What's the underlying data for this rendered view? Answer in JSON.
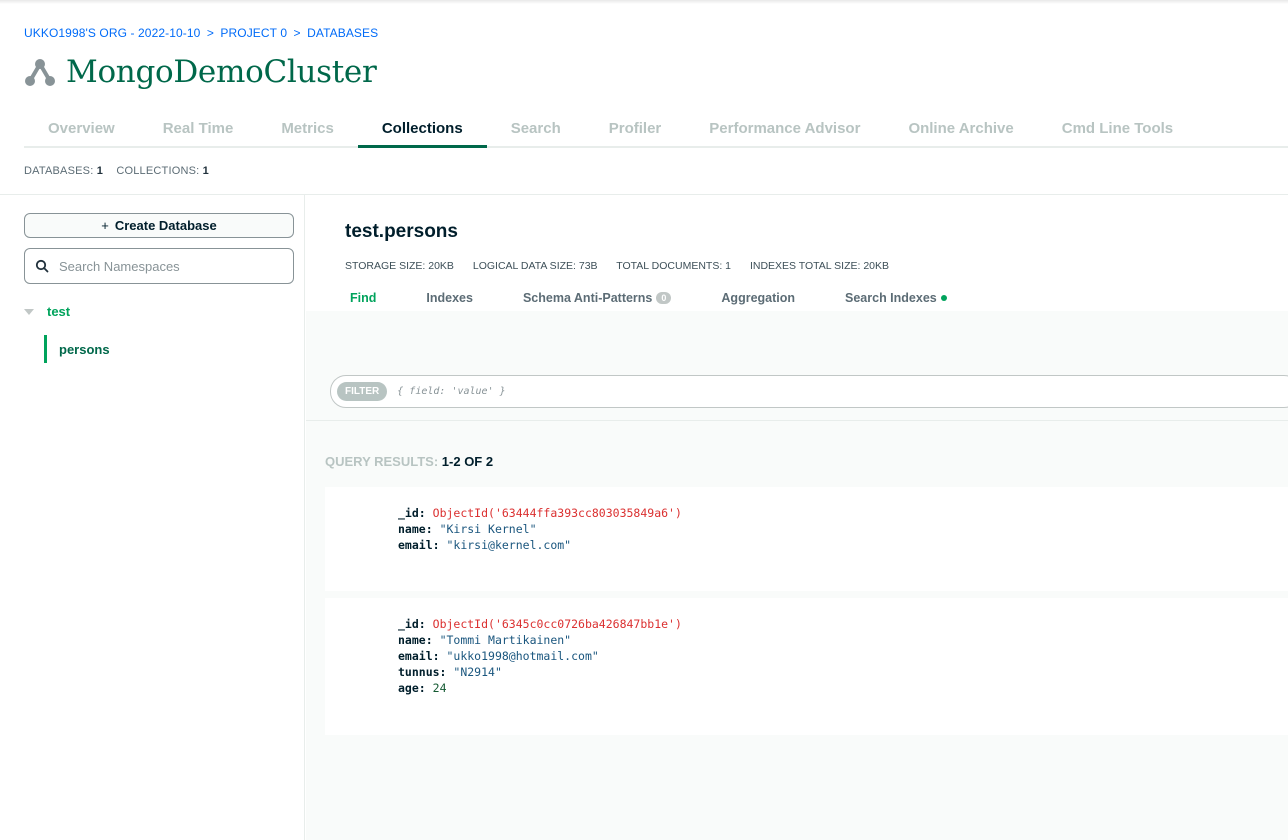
{
  "breadcrumb": {
    "org": "UKKO1998'S ORG - 2022-10-10",
    "project": "PROJECT 0",
    "section": "DATABASES",
    "separator": ">"
  },
  "page_title": "MongoDemoCluster",
  "icon_cluster": "cluster-icon",
  "tabs": [
    {
      "label": "Overview",
      "active": false
    },
    {
      "label": "Real Time",
      "active": false
    },
    {
      "label": "Metrics",
      "active": false
    },
    {
      "label": "Collections",
      "active": true
    },
    {
      "label": "Search",
      "active": false
    },
    {
      "label": "Profiler",
      "active": false
    },
    {
      "label": "Performance Advisor",
      "active": false
    },
    {
      "label": "Online Archive",
      "active": false
    },
    {
      "label": "Cmd Line Tools",
      "active": false
    }
  ],
  "counts": {
    "databases_label": "DATABASES:",
    "databases_value": "1",
    "collections_label": "COLLECTIONS:",
    "collections_value": "1"
  },
  "sidebar": {
    "create_label": "Create Database",
    "create_icon": "+",
    "search_placeholder": "Search Namespaces",
    "database": "test",
    "collection": "persons"
  },
  "main": {
    "collection_title": "test.persons",
    "stats": {
      "storage": "STORAGE SIZE: 20KB",
      "logical": "LOGICAL DATA SIZE: 73B",
      "total_docs": "TOTAL DOCUMENTS: 1",
      "indexes": "INDEXES TOTAL SIZE: 20KB"
    },
    "subtabs": {
      "find": "Find",
      "indexes": "Indexes",
      "schema": "Schema Anti-Patterns",
      "schema_badge": "0",
      "aggregation": "Aggregation",
      "search_indexes": "Search Indexes"
    },
    "filter": {
      "tag": "FILTER",
      "placeholder": "{ field: 'value' }"
    },
    "results": {
      "label": "QUERY RESULTS:",
      "value": "1-2 OF 2"
    }
  },
  "documents": [
    {
      "id_key": "_id:",
      "id_value": "ObjectId('63444ffa393cc803035849a6')",
      "name_key": "name:",
      "name_value": "\"Kirsi Kernel\"",
      "email_key": "email:",
      "email_value": "\"kirsi@kernel.com\""
    },
    {
      "id_key": "_id:",
      "id_value": "ObjectId('6345c0cc0726ba426847bb1e')",
      "name_key": "name:",
      "name_value": "\"Tommi Martikainen\"",
      "email_key": "email:",
      "email_value": "\"ukko1998@hotmail.com\"",
      "tunnus_key": "tunnus:",
      "tunnus_value": "\"N2914\"",
      "age_key": "age:",
      "age_value": "24"
    }
  ],
  "colors": {
    "brand_green": "#00684a",
    "accent_green": "#00a35c",
    "link_blue": "#016bf8",
    "objectid_red": "#db3030",
    "string_blue": "#1a567e"
  }
}
